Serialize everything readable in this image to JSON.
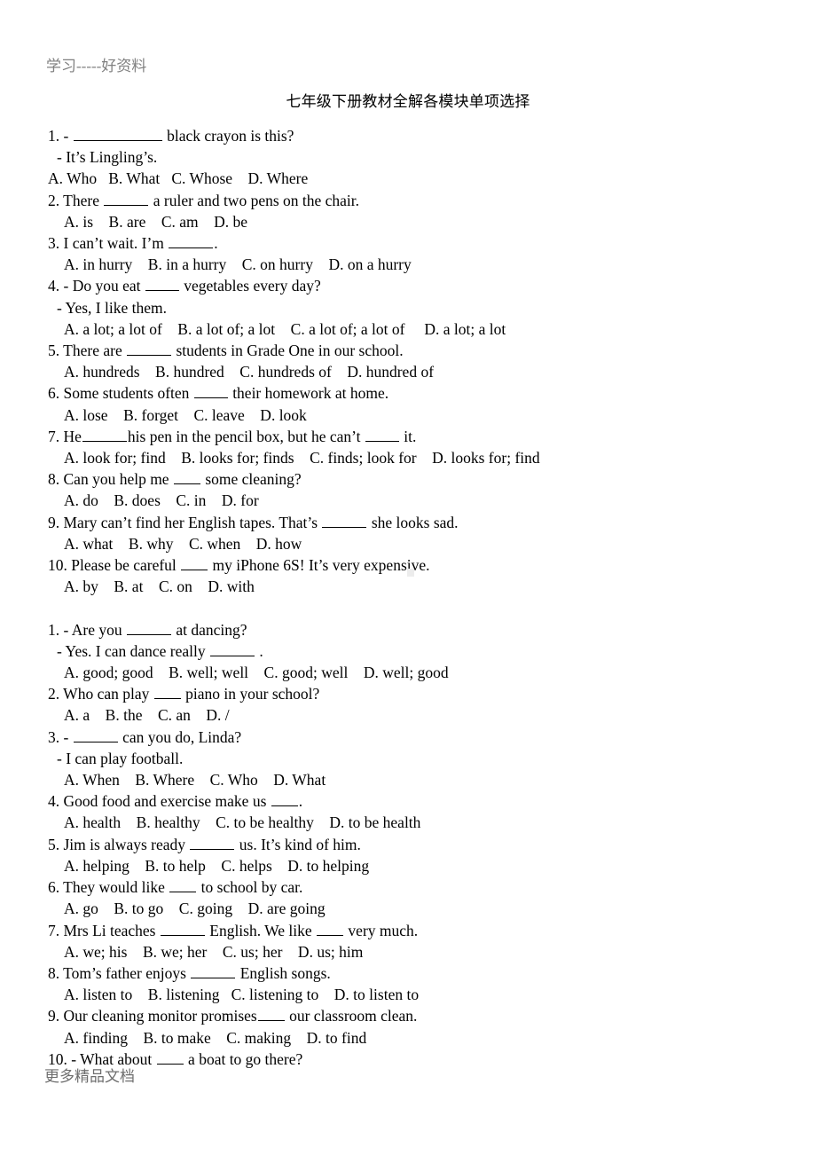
{
  "header": {
    "watermark": "学习-----好资料"
  },
  "title": "七年级下册教材全解各模块单项选择",
  "footer": {
    "watermark": "更多精品文档"
  },
  "colors": {
    "page_background": "#ffffff",
    "text": "#000000",
    "header_watermark": "#808080",
    "footer_watermark": "#6e6e6e"
  },
  "sections": [
    {
      "id": "section-1",
      "questions": [
        {
          "number": "1.",
          "stem_before": "1. - ",
          "blank": "xl",
          "stem_after": " black crayon is this?",
          "reply": "- It’s Lingling’s.",
          "options_flush": true,
          "options": "A. Who   B. What   C. Whose    D. Where"
        },
        {
          "number": "2.",
          "stem_before": "2. There ",
          "blank": "m",
          "stem_after": " a ruler and two pens on the chair.",
          "reply": null,
          "options": "A. is    B. are    C. am    D. be"
        },
        {
          "number": "3.",
          "stem_before": "3. I can’t wait. I’m ",
          "blank": "m",
          "stem_after": ".",
          "reply": null,
          "options": "A. in hurry    B. in a hurry    C. on hurry    D. on a hurry"
        },
        {
          "number": "4.",
          "stem_before": "4. - Do you eat ",
          "blank": "s",
          "stem_after": " vegetables every day?",
          "reply": "- Yes, I like them.",
          "options": "A. a lot; a lot of    B. a lot of; a lot    C. a lot of; a lot of     D. a lot; a lot"
        },
        {
          "number": "5.",
          "stem_before": "5. There are ",
          "blank": "m",
          "stem_after": " students in Grade One in our school.",
          "reply": null,
          "options": "A. hundreds    B. hundred    C. hundreds of    D. hundred of"
        },
        {
          "number": "6.",
          "stem_before": "6. Some students often ",
          "blank": "s",
          "stem_after": " their homework at home.",
          "reply": null,
          "options": "A. lose    B. forget    C. leave    D. look"
        },
        {
          "number": "7.",
          "stem_before": "7. He",
          "blank": "m",
          "stem_mid": "his pen in the pencil box, but he can’t ",
          "blank2": "s",
          "stem_after": " it.",
          "reply": null,
          "options": "A. look for; find    B. looks for; finds    C. finds; look for    D. looks for; find"
        },
        {
          "number": "8.",
          "stem_before": "8. Can you help me ",
          "blank": "xs",
          "stem_after": " some cleaning?",
          "reply": null,
          "options": "A. do    B. does    C. in    D. for"
        },
        {
          "number": "9.",
          "stem_before": "9. Mary can’t find her English tapes. That’s ",
          "blank": "m",
          "stem_after": " she looks sad.",
          "reply": null,
          "options": "A. what    B. why    C. when    D. how"
        },
        {
          "number": "10.",
          "stem_before": "10. Please be careful ",
          "blank": "xs",
          "stem_after": " my iPhone 6S! It’s very expensive.",
          "reply": null,
          "options": "A. by    B. at    C. on    D. with"
        }
      ]
    },
    {
      "id": "section-2",
      "questions": [
        {
          "number": "1.",
          "stem_before": "1. - Are you ",
          "blank": "m",
          "stem_after": " at dancing?",
          "reply_before": "- Yes. I can dance really ",
          "reply_blank": "m",
          "reply_after": " .",
          "options": "A. good; good    B. well; well    C. good; well    D. well; good"
        },
        {
          "number": "2.",
          "stem_before": "2. Who can play ",
          "blank": "xs",
          "stem_after": " piano in your school?",
          "reply": null,
          "options": "A. a    B. the    C. an    D. /"
        },
        {
          "number": "3.",
          "stem_before": "3. - ",
          "blank": "m",
          "stem_after": " can you do, Linda?",
          "reply": "- I can play football.",
          "options": "A. When    B. Where    C. Who    D. What"
        },
        {
          "number": "4.",
          "stem_before": "4. Good food and exercise make us ",
          "blank": "xs",
          "stem_after": ".",
          "reply": null,
          "options": "A. health    B. healthy    C. to be healthy    D. to be health"
        },
        {
          "number": "5.",
          "stem_before": "5. Jim is always ready ",
          "blank": "m",
          "stem_after": " us. It’s kind of him.",
          "reply": null,
          "options": "A. helping    B. to help    C. helps    D. to helping"
        },
        {
          "number": "6.",
          "stem_before": "6. They would like ",
          "blank": "xs",
          "stem_after": " to school by car.",
          "reply": null,
          "options": "A. go    B. to go    C. going    D. are going"
        },
        {
          "number": "7.",
          "stem_before": "7. Mrs Li teaches ",
          "blank": "m",
          "stem_mid": " English. We like ",
          "blank2": "xs",
          "stem_after": " very much.",
          "reply": null,
          "options": "A. we; his    B. we; her    C. us; her    D. us; him"
        },
        {
          "number": "8.",
          "stem_before": "8. Tom’s father enjoys ",
          "blank": "m",
          "stem_after": " English songs.",
          "reply": null,
          "options": "A. listen to    B. listening   C. listening to    D. to listen to"
        },
        {
          "number": "9.",
          "stem_before": "9. Our cleaning monitor promises",
          "blank": "xs",
          "stem_after": " our classroom clean.",
          "reply": null,
          "options": "A. finding    B. to make    C. making    D. to find"
        },
        {
          "number": "10.",
          "stem_before": "10. - What about ",
          "blank": "xs",
          "stem_after": " a boat to go there?",
          "reply": null,
          "options": null
        }
      ]
    }
  ]
}
